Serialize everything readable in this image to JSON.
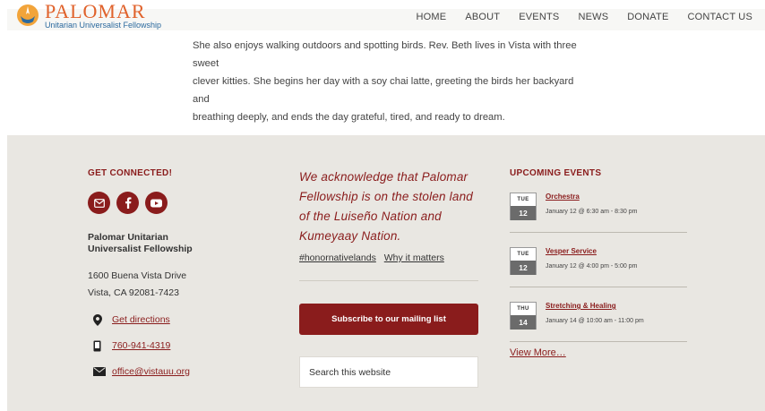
{
  "header": {
    "logo_name": "PALOMAR",
    "logo_sub": "Unitarian Universalist Fellowship",
    "nav": [
      "HOME",
      "ABOUT",
      "EVENTS",
      "NEWS",
      "DONATE",
      "CONTACT US"
    ]
  },
  "bio": {
    "line1": "She also enjoys walking outdoors and spotting birds. Rev. Beth lives in Vista with three sweet",
    "line2": "clever kitties. She begins her day with a soy chai latte, greeting the birds her backyard and",
    "line3": "breathing deeply, and ends the day grateful, tired, and ready to dream."
  },
  "connect": {
    "heading": "GET CONNECTED!",
    "org_name_1": "Palomar Unitarian",
    "org_name_2": "Universalist Fellowship",
    "address_1": "1600 Buena Vista Drive",
    "address_2": "Vista, CA 92081-7423",
    "directions": "Get directions",
    "phone": "760-941-4319",
    "email": "office@vistauu.org"
  },
  "land": {
    "acknowledgement": "We acknowledge that Palomar Fellowship is on the stolen land of the Luiseño Nation and Kumeyaay Nation.",
    "tag": "#honornativelands",
    "why": "Why it matters",
    "subscribe": "Subscribe to our mailing list",
    "search_placeholder": "Search this website"
  },
  "events": {
    "heading": "UPCOMING EVENTS",
    "items": [
      {
        "day": "TUE",
        "num": "12",
        "title": "Orchestra",
        "time": "January 12 @ 6:30 am - 8:30 pm"
      },
      {
        "day": "TUE",
        "num": "12",
        "title": "Vesper Service",
        "time": "January 12 @ 4:00 pm - 5:00 pm"
      },
      {
        "day": "THU",
        "num": "14",
        "title": "Stretching & Healing",
        "time": "January 14 @ 10:00 am - 11:00 pm"
      }
    ],
    "view_more": "View More…"
  },
  "colors": {
    "accent": "#8a1c1c",
    "footer_bg": "#e9e7e2",
    "logo_orange": "#e0622b",
    "logo_blue": "#2c6a9e"
  },
  "icons": [
    "email-icon",
    "facebook-icon",
    "youtube-icon",
    "map-pin-icon",
    "phone-icon",
    "envelope-icon"
  ]
}
